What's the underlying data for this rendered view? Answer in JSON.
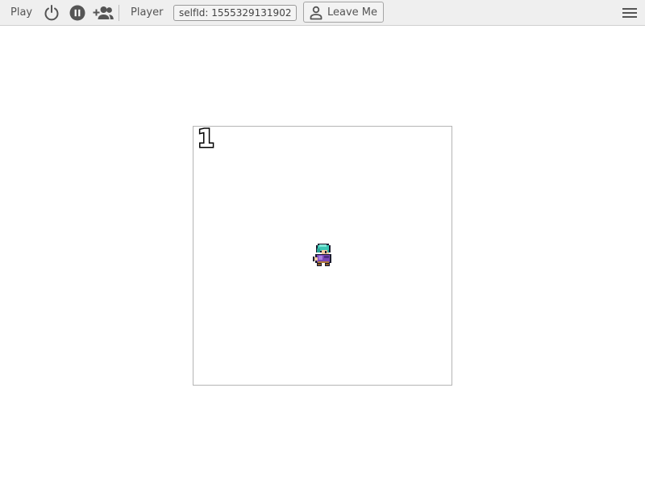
{
  "toolbar": {
    "play_label": "Play",
    "player_label": "Player",
    "selfid_text": "selfId: 1555329131902",
    "leave_label": "Leave Me",
    "icons": {
      "power": "power-icon",
      "pause": "pause-icon",
      "add_user": "add-user-icon",
      "person": "person-icon",
      "menu": "menu-icon"
    }
  },
  "game": {
    "score": "1",
    "sprite": "player-sprite"
  },
  "colors": {
    "toolbar_bg": "#efefef",
    "icon_gray": "#555555",
    "sprite_hair": "#3cc7b4",
    "sprite_cloak": "#7a46b8"
  }
}
